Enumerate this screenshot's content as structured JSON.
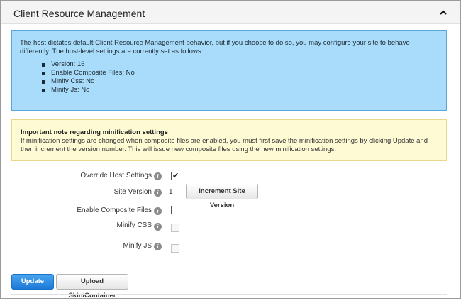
{
  "section": {
    "title": "Client Resource Management"
  },
  "info": {
    "text": "The host dictates default Client Resource Management behavior, but if you choose to do so, you may configure your site to behave differently. The host-level settings are currently set as follows:",
    "items": [
      "Version: 16",
      "Enable Composite Files: No",
      "Minify Css: No",
      "Minify Js: No"
    ]
  },
  "warning": {
    "title": "Important note regarding minification settings",
    "text": "If minification settings are changed when composite files are enabled, you must first save the minification settings by clicking Update and then increment the version number. This will issue new composite files using the new minification settings."
  },
  "form": {
    "override_label": "Override Host Settings",
    "override_checked": true,
    "site_version_label": "Site Version",
    "site_version_value": "1",
    "increment_label": "Increment Site Version",
    "composite_label": "Enable Composite Files",
    "composite_checked": false,
    "minify_css_label": "Minify CSS",
    "minify_css_checked": false,
    "minify_js_label": "Minify JS",
    "minify_js_checked": false,
    "help_glyph": "i"
  },
  "actions": {
    "update_label": "Update",
    "upload_label": "Upload Skin/Container"
  },
  "colors": {
    "info_bg": "#a8dcfa",
    "warning_bg": "#fefbd4",
    "primary": "#1d79d8"
  }
}
